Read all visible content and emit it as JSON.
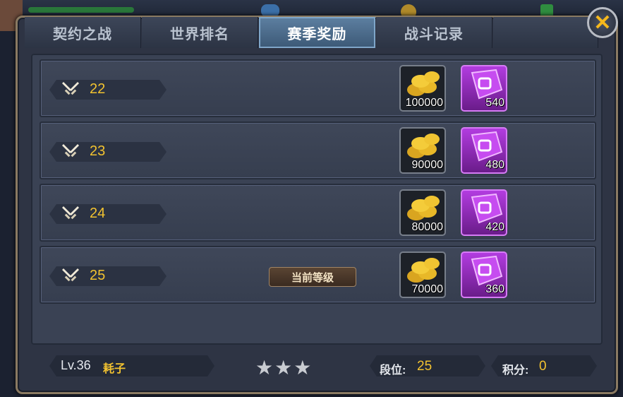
{
  "tabs": [
    {
      "label": "契约之战"
    },
    {
      "label": "世界排名"
    },
    {
      "label": "赛季奖励"
    },
    {
      "label": "战斗记录"
    }
  ],
  "active_tab": "赛季奖励",
  "rewards": [
    {
      "rank": "22",
      "coins": "100000",
      "gems": "540"
    },
    {
      "rank": "23",
      "coins": "90000",
      "gems": "480"
    },
    {
      "rank": "24",
      "coins": "80000",
      "gems": "420"
    },
    {
      "rank": "25",
      "coins": "70000",
      "gems": "360",
      "current_label": "当前等级"
    }
  ],
  "player": {
    "level": "Lv.36",
    "name": "耗子",
    "stars": "★★★",
    "rank_label": "段位:",
    "rank_value": "25",
    "score_label": "积分:",
    "score_value": "0"
  },
  "colors": {
    "accent": "#f2c230",
    "active_tab": "#4a6b8c",
    "gem": "#a135c8"
  },
  "icons": {
    "close": "close-icon",
    "rank": "crossed-swords-icon",
    "coin": "gold-coins-icon",
    "gem": "purple-gem-icon"
  }
}
